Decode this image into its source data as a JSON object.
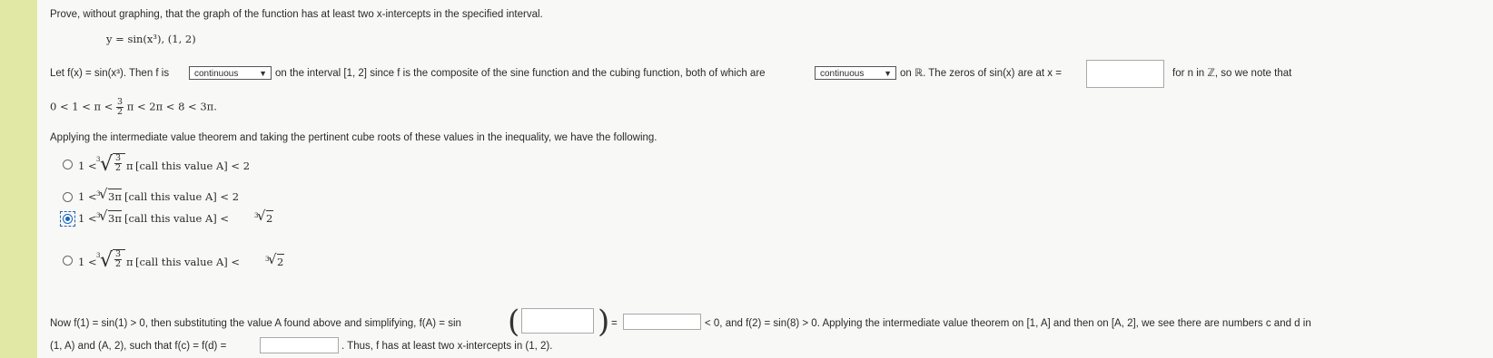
{
  "problem": {
    "instruction": "Prove, without graphing, that the graph of the function has at least two x-intercepts in the specified interval.",
    "function_line": "y = sin(x³),   (1, 2)"
  },
  "paragraph1": {
    "let_prefix": "Let f(x) = sin(x³). Then f is",
    "dropdown1_value": "continuous",
    "middle_text": "on the interval [1, 2] since f is the composite of the sine function and the cubing function, both of which are",
    "dropdown2_value": "continuous",
    "zeros_text": "on ℝ. The zeros of sin(x) are at x =",
    "answer1_value": "",
    "for_n_text": "for n in ℤ, so we note that",
    "inequality_text": "0 < 1 < π <",
    "inequality_frac_num": "3",
    "inequality_frac_den": "2",
    "inequality_rest": "π < 2π < 8 < 3π."
  },
  "paragraph2": {
    "text": "Applying the intermediate value theorem and taking the pertinent cube roots of these values in the inequality, we have the following."
  },
  "options": [
    {
      "prefix": "1 <",
      "index": "3",
      "radicand_num": "3",
      "radicand_den": "2",
      "radicand_after": "π",
      "label": "[call this value A] < 2",
      "selected": false
    },
    {
      "prefix": "1 <",
      "index": "3",
      "radicand": "3π",
      "label": "[call this value A] < 2",
      "selected": false
    },
    {
      "prefix": "1 <",
      "index": "3",
      "radicand": "3π",
      "label": "[call this value A] <",
      "tail_index": "3",
      "tail_radicand": "2",
      "selected": true
    },
    {
      "prefix": "1 <",
      "index": "3",
      "radicand_num": "3",
      "radicand_den": "2",
      "radicand_after": "π",
      "label": "[call this value A] <",
      "tail_index": "3",
      "tail_radicand": "2",
      "selected": false
    }
  ],
  "paragraph3": {
    "now_text": "Now f(1) = sin(1) > 0, then substituting the value A found above and simplifying, f(A) = sin",
    "equals": "=",
    "answer2_value": "",
    "answer3_value": "",
    "after_text": "< 0, and f(2) = sin(8) > 0. Applying the intermediate value theorem on [1, A] and then on [A, 2], we see there are numbers c and d in",
    "line2_text": "(1, A) and (A, 2), such that f(c) = f(d) =",
    "answer4_value": "",
    "thus_text": ". Thus, f has at least two x-intercepts in (1, 2)."
  },
  "colors": {
    "accent": "#1565c0",
    "sidebar": "#e1e8a6"
  }
}
